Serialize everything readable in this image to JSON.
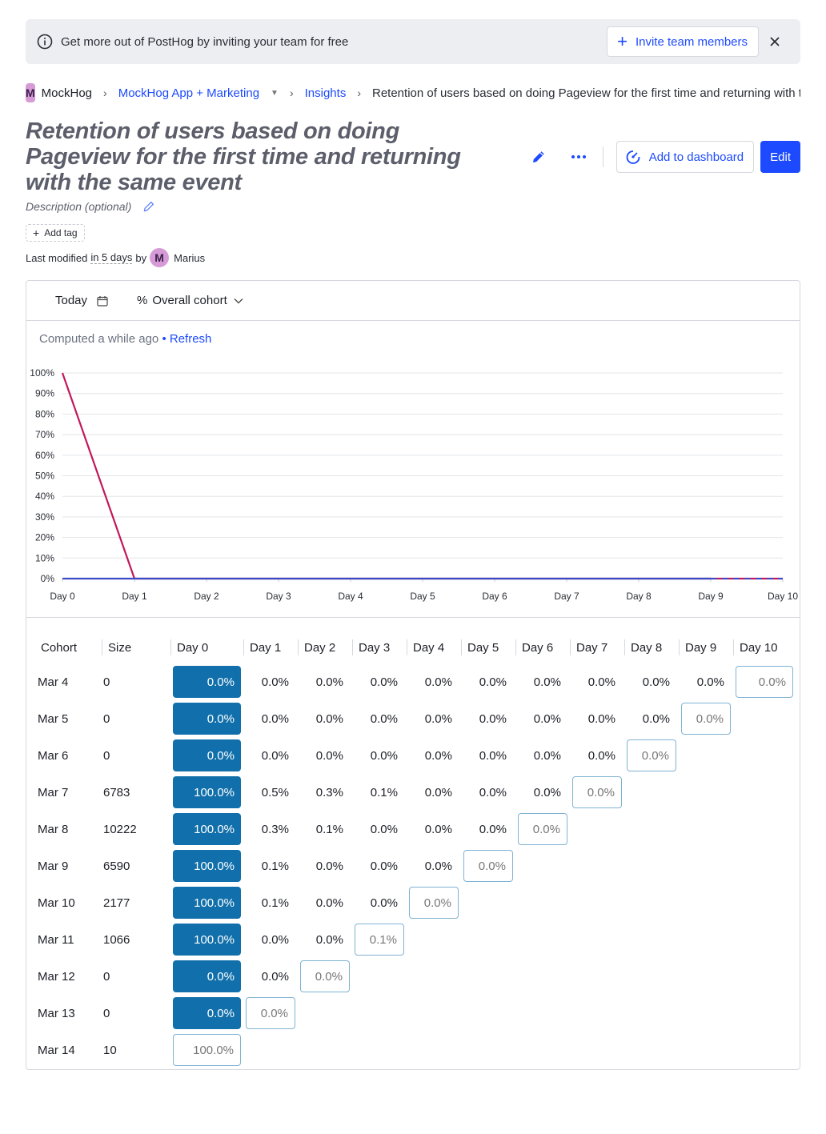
{
  "banner": {
    "message": "Get more out of PostHog by inviting your team for free",
    "invite_label": "Invite team members"
  },
  "breadcrumb": {
    "org_initial": "M",
    "org": "MockHog",
    "project": "MockHog App + Marketing",
    "section": "Insights",
    "current": "Retention of users based on doing Pageview for the first time and returning with the same event"
  },
  "insight": {
    "title": "Retention of users based on doing Pageview for the first time and returning with the same event",
    "description_placeholder": "Description (optional)",
    "add_to_dashboard": "Add to dashboard",
    "edit_label": "Edit",
    "add_tag": "Add tag",
    "modified_prefix": "Last modified",
    "modified_time": "in 5 days",
    "modified_by": "by",
    "author_initial": "M",
    "author": "Marius"
  },
  "filters": {
    "date": "Today",
    "mode_icon": "%",
    "mode": "Overall cohort"
  },
  "status": {
    "computed": "Computed a while ago",
    "bullet": "•",
    "refresh": "Refresh"
  },
  "colors": {
    "accent": "#1d4aff",
    "line": "#c2185b",
    "line2": "#3a4bc7",
    "cell_fill": "#1170ab"
  },
  "chart_data": {
    "type": "line",
    "categories": [
      "Day 0",
      "Day 1",
      "Day 2",
      "Day 3",
      "Day 4",
      "Day 5",
      "Day 6",
      "Day 7",
      "Day 8",
      "Day 9",
      "Day 10"
    ],
    "y_ticks": [
      "0%",
      "10%",
      "20%",
      "30%",
      "40%",
      "50%",
      "60%",
      "70%",
      "80%",
      "90%",
      "100%"
    ],
    "ylim": [
      0,
      100
    ],
    "grid": true,
    "series": [
      {
        "values": [
          100,
          0,
          0,
          0,
          0,
          0,
          0,
          0,
          0,
          0,
          0
        ],
        "color": "#c2185b"
      },
      {
        "values": [
          0,
          0,
          0,
          0,
          0,
          0,
          0,
          0,
          0,
          0,
          0
        ],
        "color": "#3a4bc7",
        "dashed_from": 9
      }
    ]
  },
  "table": {
    "headers": [
      "Cohort",
      "Size",
      "Day 0",
      "Day 1",
      "Day 2",
      "Day 3",
      "Day 4",
      "Day 5",
      "Day 6",
      "Day 7",
      "Day 8",
      "Day 9",
      "Day 10"
    ],
    "rows": [
      {
        "cohort": "Mar 4",
        "size": "0",
        "values": [
          "0.0%",
          "0.0%",
          "0.0%",
          "0.0%",
          "0.0%",
          "0.0%",
          "0.0%",
          "0.0%",
          "0.0%",
          "0.0%",
          "0.0%"
        ]
      },
      {
        "cohort": "Mar 5",
        "size": "0",
        "values": [
          "0.0%",
          "0.0%",
          "0.0%",
          "0.0%",
          "0.0%",
          "0.0%",
          "0.0%",
          "0.0%",
          "0.0%",
          "0.0%"
        ]
      },
      {
        "cohort": "Mar 6",
        "size": "0",
        "values": [
          "0.0%",
          "0.0%",
          "0.0%",
          "0.0%",
          "0.0%",
          "0.0%",
          "0.0%",
          "0.0%",
          "0.0%"
        ]
      },
      {
        "cohort": "Mar 7",
        "size": "6783",
        "values": [
          "100.0%",
          "0.5%",
          "0.3%",
          "0.1%",
          "0.0%",
          "0.0%",
          "0.0%",
          "0.0%"
        ]
      },
      {
        "cohort": "Mar 8",
        "size": "10222",
        "values": [
          "100.0%",
          "0.3%",
          "0.1%",
          "0.0%",
          "0.0%",
          "0.0%",
          "0.0%"
        ]
      },
      {
        "cohort": "Mar 9",
        "size": "6590",
        "values": [
          "100.0%",
          "0.1%",
          "0.0%",
          "0.0%",
          "0.0%",
          "0.0%"
        ]
      },
      {
        "cohort": "Mar 10",
        "size": "2177",
        "values": [
          "100.0%",
          "0.1%",
          "0.0%",
          "0.0%",
          "0.0%"
        ]
      },
      {
        "cohort": "Mar 11",
        "size": "1066",
        "values": [
          "100.0%",
          "0.0%",
          "0.0%",
          "0.1%"
        ]
      },
      {
        "cohort": "Mar 12",
        "size": "0",
        "values": [
          "0.0%",
          "0.0%",
          "0.0%"
        ]
      },
      {
        "cohort": "Mar 13",
        "size": "0",
        "values": [
          "0.0%",
          "0.0%"
        ]
      },
      {
        "cohort": "Mar 14",
        "size": "10",
        "values": [
          "100.0%"
        ]
      }
    ]
  }
}
